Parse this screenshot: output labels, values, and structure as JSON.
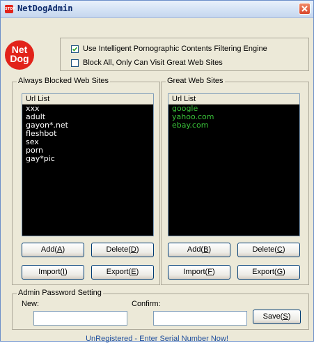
{
  "window": {
    "app_icon_text": "STOP",
    "title": "NetDogAdmin"
  },
  "logo": {
    "line1": "Net",
    "line2": "Dog"
  },
  "options": {
    "filter_engine": {
      "label": "Use Intelligent Pornographic Contents Filtering Engine",
      "checked": true
    },
    "block_all": {
      "label": "Block All, Only Can Visit Great Web Sites",
      "checked": false
    }
  },
  "blocked": {
    "title": "Always Blocked Web Sites",
    "header": "Url List",
    "items": [
      "xxx",
      "adult",
      "gayon*.net",
      "fleshbot",
      "sex",
      "porn",
      "gay*pic"
    ],
    "item_color": "#ffffff",
    "add": {
      "label": "Add(",
      "key": "A",
      "end": ")"
    },
    "delete": {
      "label": "Delete(",
      "key": "D",
      "end": ")"
    },
    "import": {
      "label": "Import(",
      "key": "I",
      "end": ")"
    },
    "export": {
      "label": "Export(",
      "key": "E",
      "end": ")"
    }
  },
  "great": {
    "title": "Great Web Sites",
    "header": "Url List",
    "items": [
      "google",
      "yahoo.com",
      "ebay.com"
    ],
    "item_color": "#39c239",
    "add": {
      "label": "Add(",
      "key": "B",
      "end": ")"
    },
    "delete": {
      "label": "Delete(",
      "key": "C",
      "end": ")"
    },
    "import": {
      "label": "Import(",
      "key": "F",
      "end": ")"
    },
    "export": {
      "label": "Export(",
      "key": "G",
      "end": ")"
    }
  },
  "password": {
    "title": "Admin Password Setting",
    "new_label": "New:",
    "new_value": "",
    "confirm_label": "Confirm:",
    "confirm_value": "",
    "save": {
      "label": "Save(",
      "key": "S",
      "end": ")"
    }
  },
  "status": "UnRegistered - Enter Serial Number Now!"
}
